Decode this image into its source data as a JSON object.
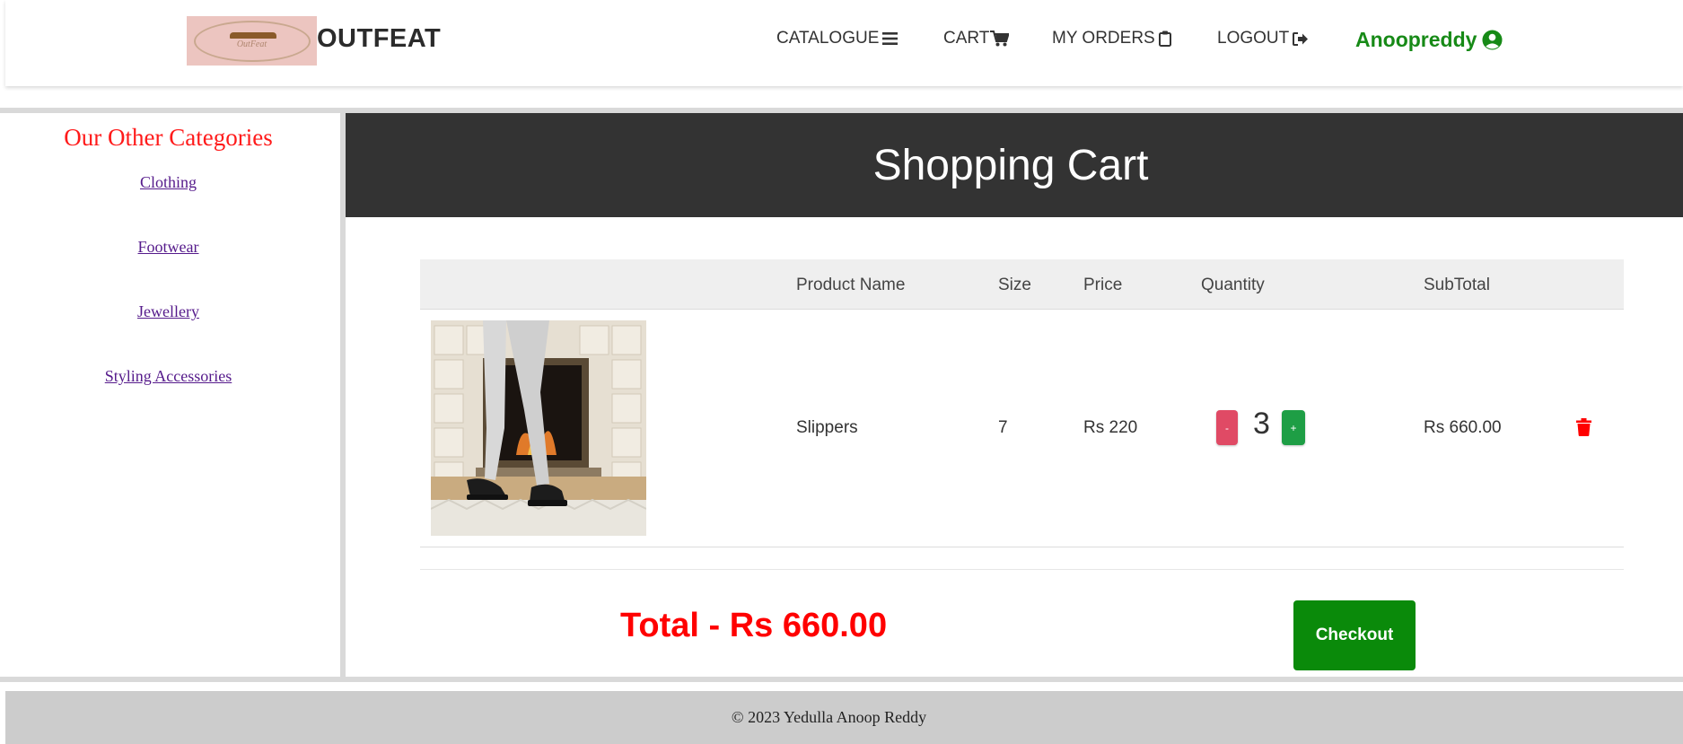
{
  "header": {
    "logo_text": "OutFeat",
    "brand": "OUTFEAT",
    "nav": {
      "catalogue": "CATALOGUE",
      "cart": "CART",
      "my_orders": "MY ORDERS",
      "logout": "LOGOUT",
      "user": "Anoopreddy"
    },
    "icons": {
      "catalogue": "bars-icon",
      "cart": "cart-icon",
      "my_orders": "clipboard-icon",
      "logout": "sign-out-icon",
      "user": "user-circle-icon"
    }
  },
  "sidebar": {
    "title": "Our Other Categories",
    "items": [
      {
        "label": "Clothing"
      },
      {
        "label": "Footwear"
      },
      {
        "label": "Jewellery"
      },
      {
        "label": "Styling Accessories"
      }
    ]
  },
  "main": {
    "title": "Shopping Cart",
    "table": {
      "headers": {
        "product_name": "Product Name",
        "size": "Size",
        "price": "Price",
        "quantity": "Quantity",
        "subtotal": "SubTotal"
      },
      "rows": [
        {
          "product_name": "Slippers",
          "size": "7",
          "price": "Rs 220",
          "quantity": "3",
          "minus_label": "-",
          "plus_label": "+",
          "subtotal": "Rs 660.00",
          "delete_icon": "trash-icon"
        }
      ]
    },
    "total": "Total - Rs 660.00",
    "checkout_label": "Checkout"
  },
  "footer": {
    "copyright": "© 2023 Yedulla Anoop Reddy"
  },
  "colors": {
    "sidebar_title": "#ff1a1a",
    "user_name": "#178a17",
    "title_bar": "#333333",
    "total": "#ff0000",
    "checkout": "#0a8a0a",
    "minus_button": "#e04a65",
    "plus_button": "#1e9e45",
    "delete_icon": "#ff0000"
  }
}
